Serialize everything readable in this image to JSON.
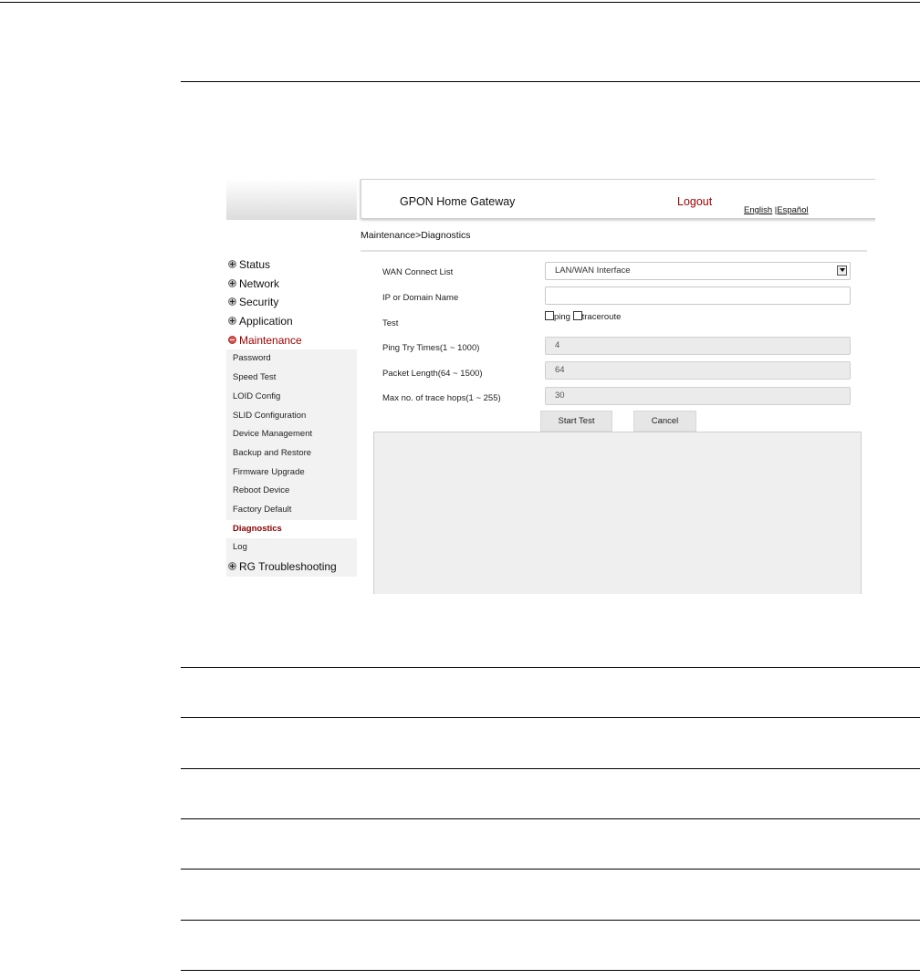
{
  "header": {
    "brand": "GPON Home Gateway",
    "logout": "Logout",
    "lang_english": "English",
    "lang_sep": " |",
    "lang_espanol": "Español"
  },
  "breadcrumb": "Maintenance>Diagnostics",
  "sidebar": {
    "status": "Status",
    "network": "Network",
    "security": "Security",
    "application": "Application",
    "maintenance": "Maintenance",
    "maintenance_items": [
      "Password",
      "Speed Test",
      "LOID Config",
      "SLID Configuration",
      "Device Management",
      "Backup and Restore",
      "Firmware Upgrade",
      "Reboot Device",
      "Factory Default",
      "Diagnostics",
      "Log"
    ],
    "rg_troubleshooting": "RG Troubleshooting"
  },
  "form": {
    "wan_label": "WAN Connect List",
    "wan_value": "LAN/WAN Interface",
    "ip_label": "IP or Domain Name",
    "ip_value": "",
    "test_label": "Test",
    "test_ping": "ping",
    "test_traceroute": "traceroute",
    "ping_label": "Ping Try Times(1 ~ 1000)",
    "ping_value": "4",
    "packet_label": "Packet Length(64 ~ 1500)",
    "packet_value": "64",
    "hops_label": "Max no. of trace hops(1 ~ 255)",
    "hops_value": "30",
    "start_button": "Start Test",
    "cancel_button": "Cancel"
  },
  "colors": {
    "accent": "#9b0000",
    "active_nav": "#8b0000"
  }
}
